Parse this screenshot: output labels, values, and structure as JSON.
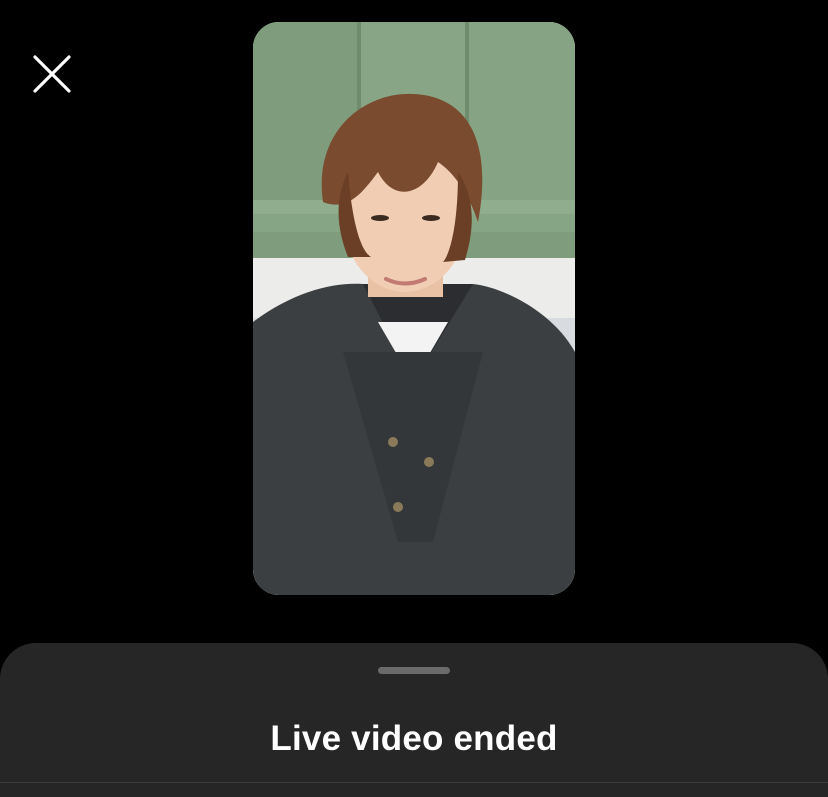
{
  "header": {
    "close_icon": "close-icon"
  },
  "video": {
    "thumbnail": "live-video-preview"
  },
  "sheet": {
    "title": "Live video ended"
  },
  "colors": {
    "background": "#000000",
    "sheet_background": "#262626",
    "title_text": "#ffffff",
    "handle": "#6b6b6b"
  }
}
